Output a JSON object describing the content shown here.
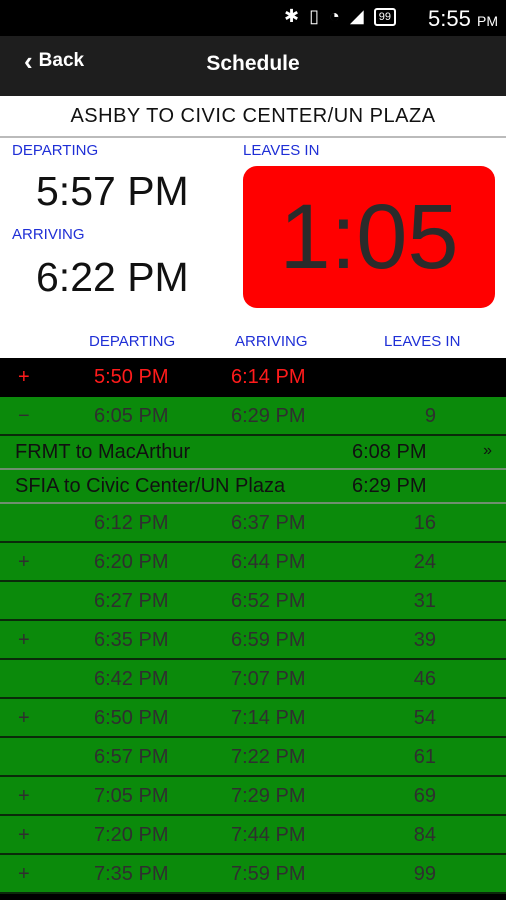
{
  "status": {
    "time": "5:55",
    "ampm": "PM",
    "battery": "99"
  },
  "actionbar": {
    "back_label": "Back",
    "title": "Schedule"
  },
  "route": "ASHBY TO CIVIC CENTER/UN PLAZA",
  "summary": {
    "departing_label": "DEPARTING",
    "departing_time": "5:57 PM",
    "arriving_label": "ARRIVING",
    "arriving_time": "6:22 PM",
    "leaves_in_label": "LEAVES IN",
    "countdown": "1:05"
  },
  "columns": {
    "departing": "DEPARTING",
    "arriving": "ARRIVING",
    "leaves_in": "LEAVES IN"
  },
  "rows": [
    {
      "sign": "+",
      "dep": "5:50 PM",
      "arr": "6:14 PM",
      "leaves": ""
    },
    {
      "sign": "−",
      "dep": "6:05 PM",
      "arr": "6:29 PM",
      "leaves": "9"
    },
    {
      "sign": "",
      "dep": "6:12 PM",
      "arr": "6:37 PM",
      "leaves": "16"
    },
    {
      "sign": "+",
      "dep": "6:20 PM",
      "arr": "6:44 PM",
      "leaves": "24"
    },
    {
      "sign": "",
      "dep": "6:27 PM",
      "arr": "6:52 PM",
      "leaves": "31"
    },
    {
      "sign": "+",
      "dep": "6:35 PM",
      "arr": "6:59 PM",
      "leaves": "39"
    },
    {
      "sign": "",
      "dep": "6:42 PM",
      "arr": "7:07 PM",
      "leaves": "46"
    },
    {
      "sign": "+",
      "dep": "6:50 PM",
      "arr": "7:14 PM",
      "leaves": "54"
    },
    {
      "sign": "",
      "dep": "6:57 PM",
      "arr": "7:22 PM",
      "leaves": "61"
    },
    {
      "sign": "+",
      "dep": "7:05 PM",
      "arr": "7:29 PM",
      "leaves": "69"
    },
    {
      "sign": "+",
      "dep": "7:20 PM",
      "arr": "7:44 PM",
      "leaves": "84"
    },
    {
      "sign": "+",
      "dep": "7:35 PM",
      "arr": "7:59 PM",
      "leaves": "99"
    }
  ],
  "transfers": [
    {
      "name": "FRMT to MacArthur",
      "time": "6:08 PM",
      "arrow": "»"
    },
    {
      "name": "SFIA to Civic Center/UN Plaza",
      "time": "6:29 PM",
      "arrow": ""
    }
  ],
  "colors": {
    "current_bg": "#000000",
    "current_text": "#ff1b1b",
    "row_bg": "#0b8a0b",
    "countdown_bg": "#ff0000",
    "label_blue": "#1f2fd6"
  },
  "icons": [
    "bluetooth-icon",
    "vibrate-icon",
    "wifi-icon",
    "signal-icon",
    "battery-icon",
    "back-chevron-icon",
    "transfer-arrow-icon"
  ]
}
